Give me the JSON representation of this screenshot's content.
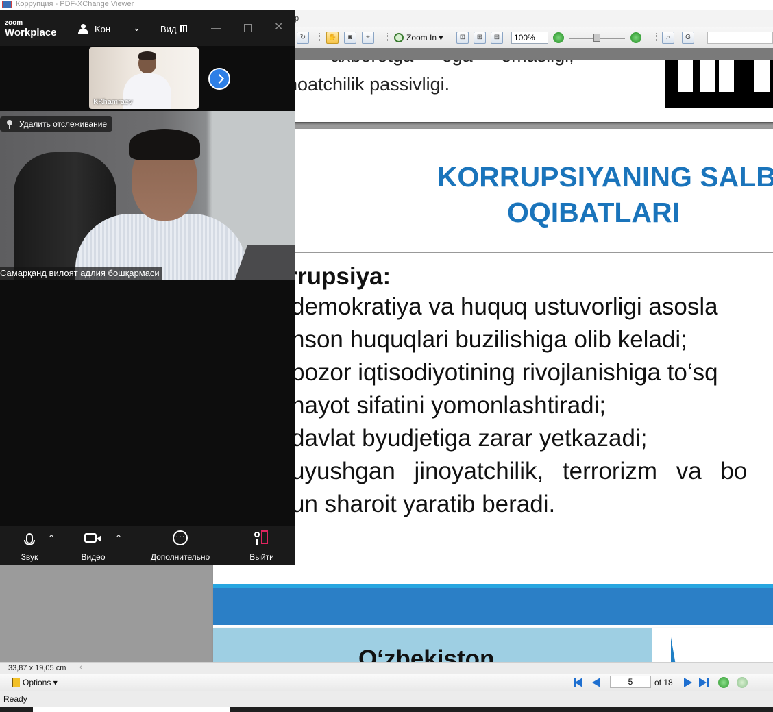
{
  "pdf_window": {
    "title": "Коррупция - PDF-XChange Viewer",
    "menu_fragment": "p",
    "toolbar": {
      "zoom_in_label": "Zoom In",
      "zoom_value": "100%"
    },
    "previous_page_text": {
      "line1": "axborotga    ega     emasligi,",
      "line2": "noatchilik passivligi."
    },
    "slide": {
      "title_line1": "KORRUPSIYANING SALBI",
      "title_line2": "OQIBATLARI",
      "heading": "orrupsiya:",
      "bullets": [
        "demokratiya va huquq ustuvorligi asosla",
        "nson huquqlari buzilishiga olib keladi;",
        "bozor iqtisodiyotining rivojlanishiga to‘sq",
        "hayot sifatini yomonlashtiradi;",
        "davlat byudjetiga zarar yetkazadi;",
        "uyushgan jinoyatchilik, terrorizm va bo",
        "un sharoit yaratib beradi."
      ]
    },
    "next_page_word": "O‘zbekiston",
    "status": {
      "page_dimensions": "33,87 x 19,05 cm",
      "options_label": "Options",
      "current_page": "5",
      "page_total": "of 18",
      "ready": "Ready"
    },
    "colors": {
      "title_blue": "#1a74bb",
      "bar_blue": "#2b7fc6",
      "nav_blue": "#1e6fd0"
    }
  },
  "zoom_window": {
    "logo_small": "zoom",
    "logo_big": "Workplace",
    "participants_label": "Koн",
    "view_label": "Вид",
    "thumbnail_name": "KKhamraev",
    "spotlight_label": "Удалить отслеживание",
    "main_speaker_name": "Самарқанд вилоят адлия бошқармаси",
    "controls": {
      "audio": "Звук",
      "video": "Видео",
      "more": "Дополнительно",
      "leave": "Выйти"
    },
    "colors": {
      "accent_blue": "#2d7fe6",
      "leave_red": "#e0245e"
    }
  }
}
